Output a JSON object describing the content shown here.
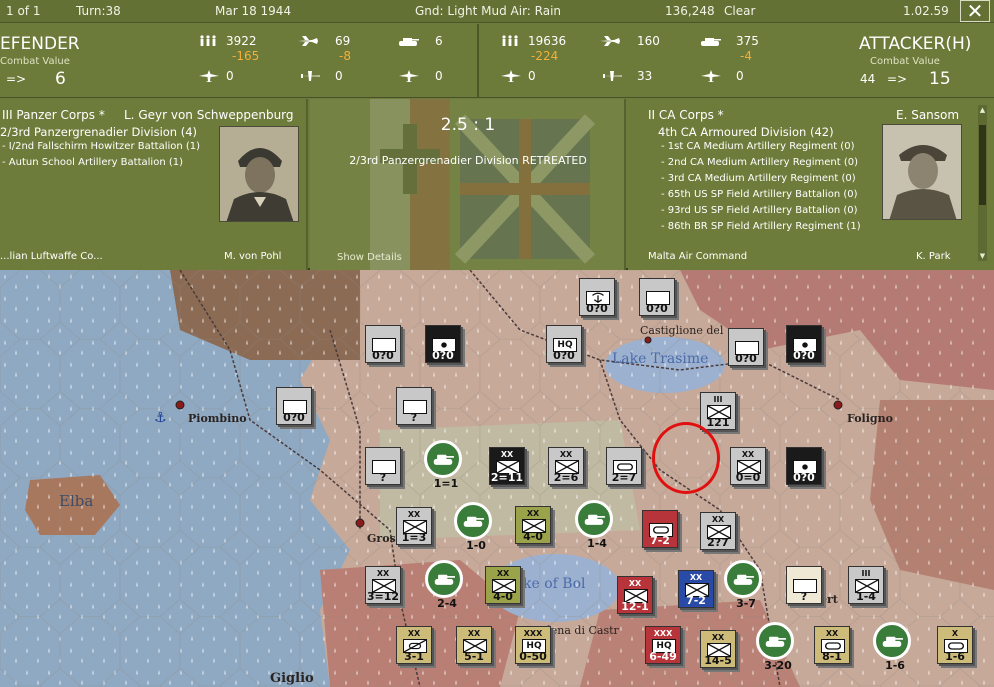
{
  "topbar": {
    "page": "1 of 1",
    "turn": "Turn:38",
    "date": "Mar 18 1944",
    "weather": "Gnd: Light Mud  Air: Rain",
    "score": "136,248",
    "condition": "Clear",
    "version": "1.02.59",
    "close_label": "✕"
  },
  "defender": {
    "title": "EFENDER",
    "cv_label": "Combat Value",
    "arrow": "=>",
    "cv": "6",
    "men": "3922",
    "men_loss": "-165",
    "fighters": "69",
    "fighters_loss": "-8",
    "tanks": "6",
    "air2": "0",
    "air3": "0",
    "air4": "0",
    "corps": "III Panzer Corps *",
    "leader": "L. Geyr von Schweppenburg",
    "division": "2/3rd Panzergrenadier Division (4)",
    "units": [
      "- I/2nd Fallschirm Howitzer Battalion (1)",
      "- Autun School Artillery Battalion (1)"
    ],
    "cut_left": "...lian Luftwaffe Co...",
    "cut_right": "M. von Pohl"
  },
  "attacker": {
    "title": "ATTACKER(H)",
    "cv_label": "Combat Value",
    "cv_prefix": "44",
    "arrow": "=>",
    "cv": "15",
    "men": "19636",
    "men_loss": "-224",
    "fighters": "160",
    "tanks": "375",
    "tanks_loss": "-4",
    "air2": "0",
    "air3": "33",
    "air4": "0",
    "corps": "II CA Corps *",
    "leader": "E. Sansom",
    "division": "4th CA Armoured Division (42)",
    "units": [
      "- 1st CA Medium Artillery Regiment (0)",
      "- 2nd CA Medium Artillery Regiment (0)",
      "- 3rd CA Medium Artillery Regiment (0)",
      "- 65th US SP Field Artillery Battalion (0)",
      "- 93rd US SP Field Artillery Battalion (0)",
      "- 86th BR SP Field Artillery Regiment (1)"
    ],
    "cut_left": "Malta Air Command",
    "cut_right": "K. Park"
  },
  "result": {
    "odds": "2.5 : 1",
    "message": "2/3rd Panzergrenadier Division RETREATED",
    "show_details": "Show Details"
  },
  "map": {
    "cities": [
      "Piombino",
      "Foligno",
      "Castiglione del",
      "Gros",
      "Giglio",
      "rlena di Castr",
      "ert"
    ],
    "lakes": [
      "Lake Trasime",
      "ke of Bol"
    ],
    "islands": [
      "Elba"
    ],
    "counters": [
      {
        "id": "c1",
        "style": "grey",
        "sym": "para",
        "str": "0?0"
      },
      {
        "id": "c2",
        "style": "grey",
        "sym": "box",
        "str": "0?0"
      },
      {
        "id": "c3",
        "style": "grey",
        "sym": "box",
        "str": "0?0"
      },
      {
        "id": "c4",
        "style": "black",
        "sym": "art",
        "str": "0?0"
      },
      {
        "id": "c5",
        "style": "grey",
        "sym": "hq",
        "str": "0?0",
        "label": "HQ"
      },
      {
        "id": "c6",
        "style": "grey",
        "sym": "box",
        "str": "0?0"
      },
      {
        "id": "c7",
        "style": "black",
        "sym": "art",
        "str": "0?0"
      },
      {
        "id": "c8",
        "style": "grey",
        "sym": "box",
        "str": "0?0"
      },
      {
        "id": "c9",
        "style": "grey",
        "sym": "box",
        "str": "?"
      },
      {
        "id": "c10",
        "style": "grey",
        "sym": "box",
        "str": "?"
      },
      {
        "id": "c11",
        "style": "grey",
        "sym": "inf",
        "str": "121",
        "size": "III"
      },
      {
        "id": "c12",
        "style": "black",
        "sym": "inf",
        "str": "2=11",
        "size": "XX"
      },
      {
        "id": "c13",
        "style": "grey",
        "sym": "inf",
        "str": "2=6",
        "size": "XX"
      },
      {
        "id": "c14",
        "style": "grey",
        "sym": "arm",
        "str": "2=7"
      },
      {
        "id": "c15",
        "style": "grey",
        "sym": "inf",
        "str": "0=0",
        "size": "XX"
      },
      {
        "id": "c16",
        "style": "black",
        "sym": "art",
        "str": "0?0"
      },
      {
        "id": "c17",
        "style": "grey",
        "sym": "inf",
        "str": "1=3",
        "size": "XX"
      },
      {
        "id": "c18",
        "style": "green",
        "sym": "inf",
        "str": "4-0",
        "size": "XX"
      },
      {
        "id": "c19",
        "style": "red",
        "sym": "arm",
        "str": "7-2"
      },
      {
        "id": "c20",
        "style": "grey",
        "sym": "inf",
        "str": "2?7",
        "size": "XX"
      },
      {
        "id": "c21",
        "style": "grey",
        "sym": "inf",
        "str": "3=12",
        "size": "XX"
      },
      {
        "id": "c22",
        "style": "green",
        "sym": "inf",
        "str": "4-0",
        "size": "XX"
      },
      {
        "id": "c23",
        "style": "red",
        "sym": "inf",
        "str": "12-1",
        "size": "XX"
      },
      {
        "id": "c24",
        "style": "blue",
        "sym": "inf",
        "str": "7-2",
        "size": "XX"
      },
      {
        "id": "c25",
        "style": "cream",
        "sym": "box",
        "str": "?"
      },
      {
        "id": "c26",
        "style": "grey",
        "sym": "inf",
        "str": "1-4",
        "size": "III"
      },
      {
        "id": "c27",
        "style": "tan",
        "sym": "recon",
        "str": "3-1",
        "size": "XX"
      },
      {
        "id": "c28",
        "style": "tan",
        "sym": "inf",
        "str": "5-1",
        "size": "XX"
      },
      {
        "id": "c29",
        "style": "tan",
        "sym": "hq",
        "str": "0-50",
        "size": "XXX",
        "label": "HQ"
      },
      {
        "id": "c30",
        "style": "red",
        "sym": "hq",
        "str": "6-49",
        "size": "XXX",
        "label": "HQ"
      },
      {
        "id": "c31",
        "style": "tan",
        "sym": "inf",
        "str": "14-5",
        "size": "XX"
      },
      {
        "id": "c32",
        "style": "tan",
        "sym": "arm",
        "str": "8-1",
        "size": "XX"
      },
      {
        "id": "c33",
        "style": "tan",
        "sym": "arm",
        "str": "1-6",
        "size": "X"
      }
    ],
    "discs": [
      {
        "id": "d1",
        "str": "1=1"
      },
      {
        "id": "d2",
        "str": "1-0"
      },
      {
        "id": "d3",
        "str": "1-4"
      },
      {
        "id": "d4",
        "str": "2-4"
      },
      {
        "id": "d5",
        "str": "3-20"
      },
      {
        "id": "d6",
        "str": "3-7"
      },
      {
        "id": "d7",
        "str": "1-6"
      }
    ]
  }
}
